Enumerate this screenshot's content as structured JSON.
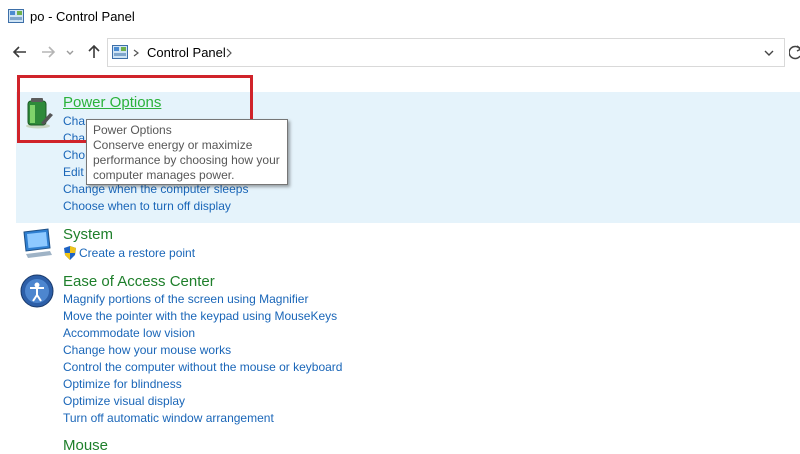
{
  "window": {
    "title": "po - Control Panel",
    "icon": "control-panel-icon"
  },
  "nav": {
    "back_icon": "arrow-left-icon",
    "forward_icon": "arrow-right-icon",
    "recent_icon": "chevron-down-icon",
    "up_icon": "arrow-up-icon",
    "address_icon": "control-panel-icon",
    "breadcrumb": "Control Panel",
    "breadcrumb_chevron": "chevron-right-icon",
    "dropdown_icon": "chevron-down-icon",
    "refresh_icon": "refresh-icon"
  },
  "categories": [
    {
      "title": "Power Options",
      "icon": "battery-icon",
      "tasks": [
        "Cha",
        "Cha",
        "Cho",
        "Edit",
        "Change when the computer sleeps",
        "Choose when to turn off display"
      ]
    },
    {
      "title": "System",
      "icon": "monitor-icon",
      "tasks": [
        "Create a restore point"
      ]
    },
    {
      "title": "Ease of Access Center",
      "icon": "ease-of-access-icon",
      "tasks": [
        "Magnify portions of the screen using Magnifier",
        "Move the pointer with the keypad using MouseKeys",
        "Accommodate low vision",
        "Change how your mouse works",
        "Control the computer without the mouse or keyboard",
        "Optimize for blindness",
        "Optimize visual display",
        "Turn off automatic window arrangement"
      ]
    },
    {
      "title": "Mouse",
      "icon": "mouse-icon",
      "tasks": []
    }
  ],
  "tooltip": {
    "title": "Power Options",
    "line1": "Conserve energy or maximize",
    "line2": "performance by choosing how your",
    "line3": "computer manages power."
  },
  "colors": {
    "category_title": "#1e7f2b",
    "category_title_hover": "#2bb23b",
    "task_link": "#1a66b8",
    "highlight_band": "#e5f3fb",
    "annotation": "#d0232a"
  }
}
